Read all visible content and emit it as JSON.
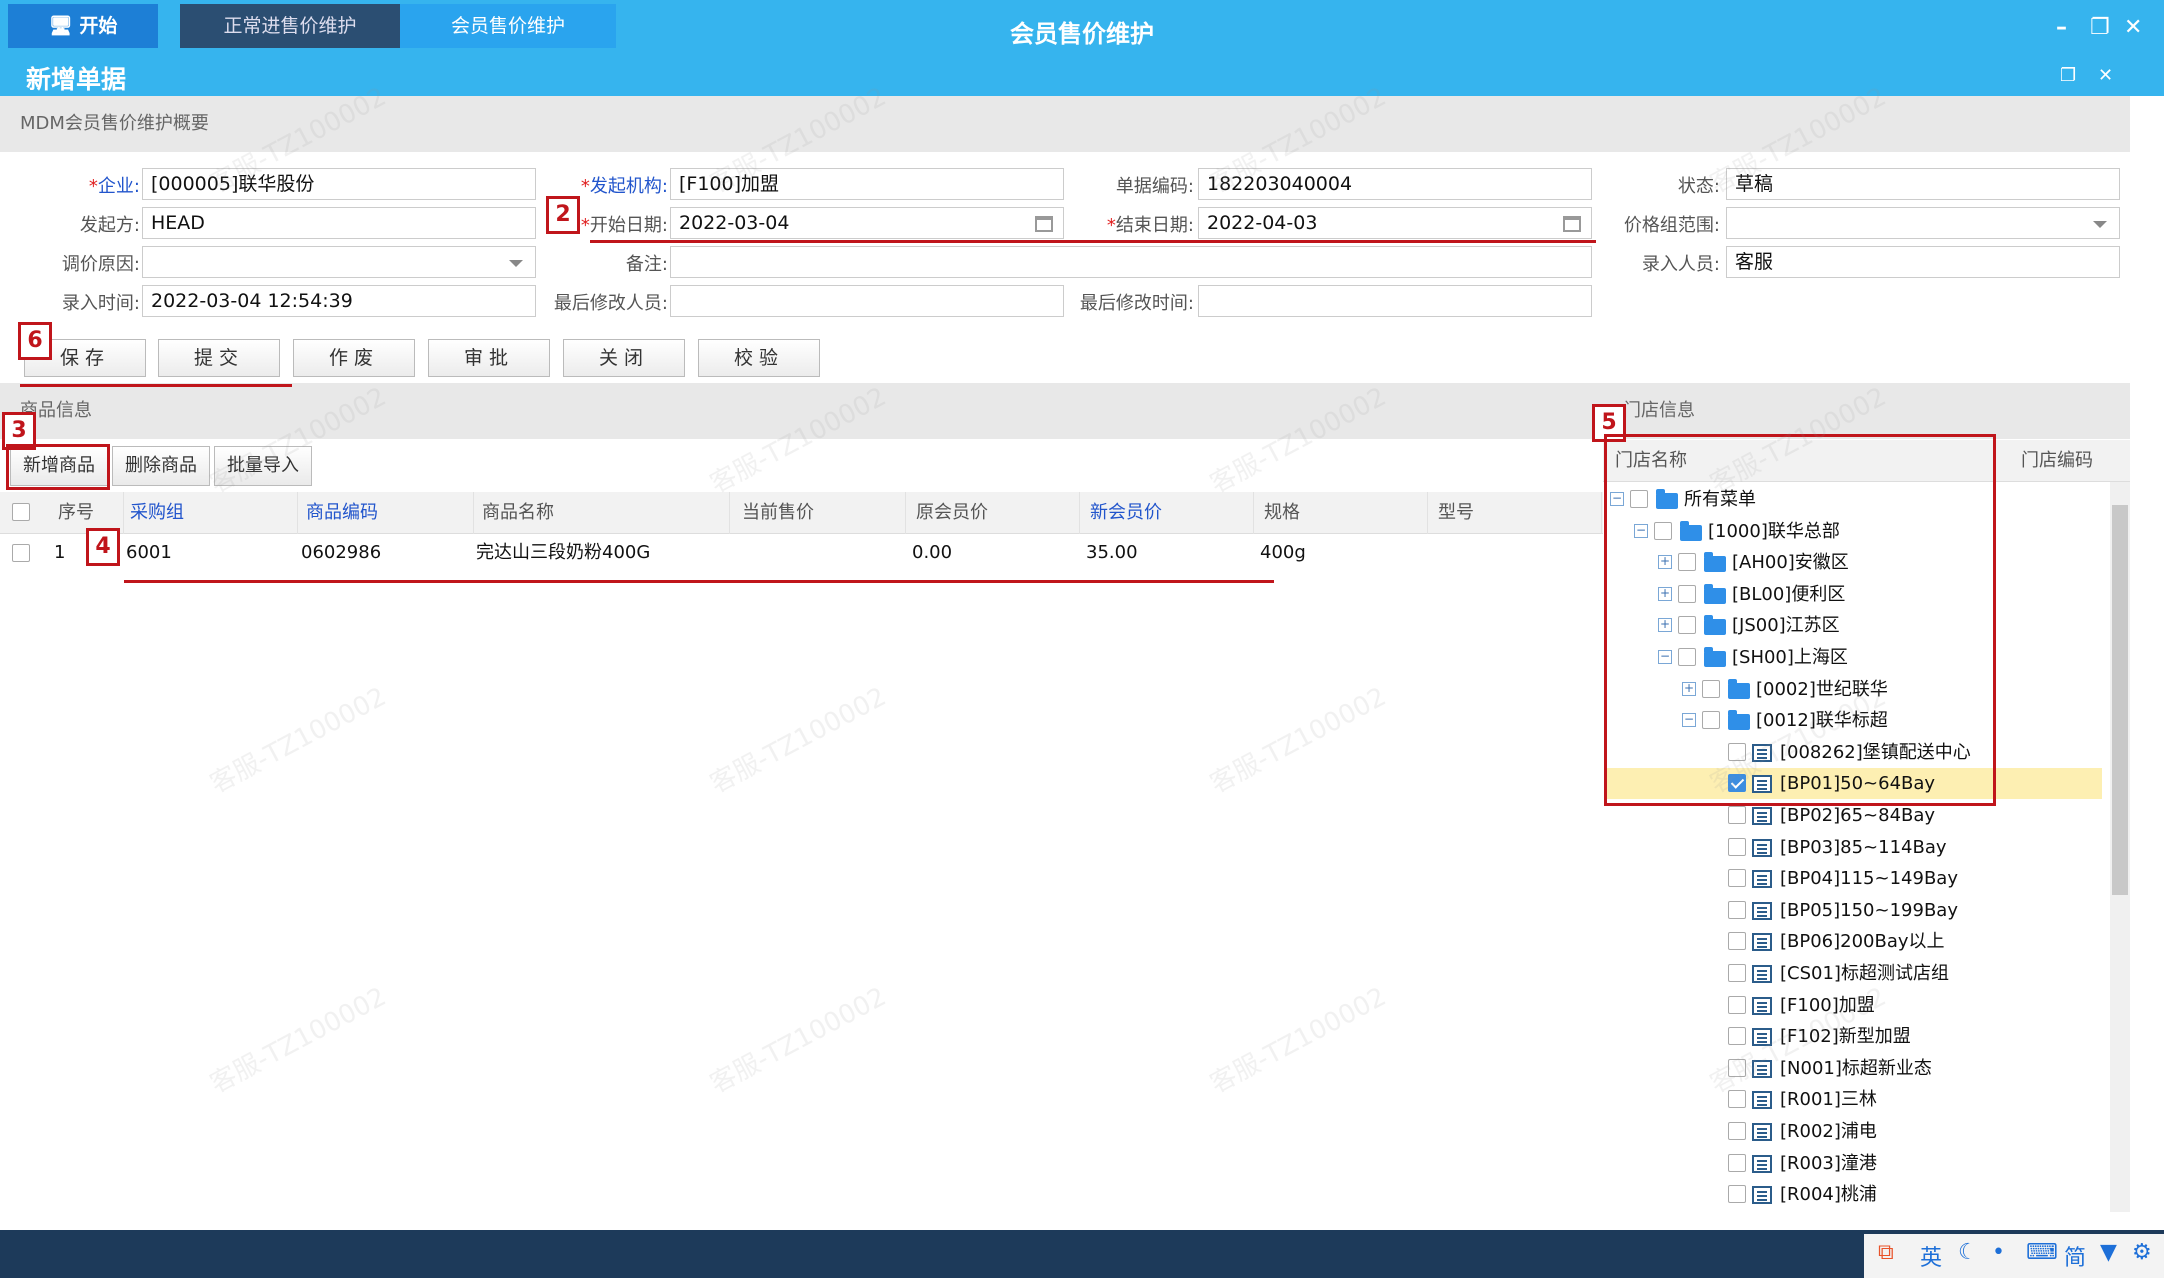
{
  "window": {
    "title": "会员售价维护",
    "subtitle": "新增单据"
  },
  "summary_title": "MDM会员售价维护概要",
  "form": {
    "company_label": "企业:",
    "company_value": "[000005]联华股份",
    "org_label": "发起机构:",
    "org_value": "[F100]加盟",
    "docno_label": "单据编码:",
    "docno_value": "182203040004",
    "status_label": "状态:",
    "status_value": "草稿",
    "initiator_label": "发起方:",
    "initiator_value": "HEAD",
    "start_label": "开始日期:",
    "start_value": "2022-03-04",
    "end_label": "结束日期:",
    "end_value": "2022-04-03",
    "pricegroup_label": "价格组范围:",
    "pricegroup_value": "",
    "reason_label": "调价原因:",
    "reason_value": "",
    "remark_label": "备注:",
    "remark_value": "",
    "entrant_label": "录入人员:",
    "entrant_value": "客服",
    "entrytime_label": "录入时间:",
    "entrytime_value": "2022-03-04 12:54:39",
    "modifier_label": "最后修改人员:",
    "modifier_value": "",
    "modtime_label": "最后修改时间:",
    "modtime_value": ""
  },
  "actions": {
    "save": "保存",
    "submit": "提交",
    "void": "作废",
    "approve": "审批",
    "close": "关闭",
    "verify": "校验"
  },
  "goods": {
    "section_title": "商品信息",
    "toolbar": {
      "add": "新增商品",
      "delete": "删除商品",
      "import": "批量导入"
    },
    "columns": [
      "序号",
      "采购组",
      "商品编码",
      "商品名称",
      "当前售价",
      "原会员价",
      "新会员价",
      "规格",
      "型号"
    ],
    "rows": [
      {
        "seq": "1",
        "group": "6001",
        "code": "0602986",
        "name": "完达山三段奶粉400G",
        "current": "",
        "orig": "0.00",
        "new": "35.00",
        "spec": "400g",
        "model": ""
      }
    ]
  },
  "stores": {
    "section_title": "门店信息",
    "col_name": "门店名称",
    "col_code": "门店编码",
    "tree": [
      {
        "label": "所有菜单",
        "level": 0,
        "type": "folder-open",
        "exp": "minus",
        "checked": false
      },
      {
        "label": "[1000]联华总部",
        "level": 1,
        "type": "folder-open",
        "exp": "minus",
        "checked": false
      },
      {
        "label": "[AH00]安徽区",
        "level": 2,
        "type": "folder",
        "exp": "plus",
        "checked": false
      },
      {
        "label": "[BL00]便利区",
        "level": 2,
        "type": "folder",
        "exp": "plus",
        "checked": false
      },
      {
        "label": "[JS00]江苏区",
        "level": 2,
        "type": "folder",
        "exp": "plus",
        "checked": false
      },
      {
        "label": "[SH00]上海区",
        "level": 2,
        "type": "folder-open",
        "exp": "minus",
        "checked": false
      },
      {
        "label": "[0002]世纪联华",
        "level": 3,
        "type": "folder",
        "exp": "plus",
        "checked": false
      },
      {
        "label": "[0012]联华标超",
        "level": 3,
        "type": "folder-open",
        "exp": "minus",
        "checked": false
      },
      {
        "label": "[008262]堡镇配送中心",
        "level": 4,
        "type": "leaf",
        "exp": "",
        "checked": false
      },
      {
        "label": "[BP01]50~64Bay",
        "level": 4,
        "type": "leaf",
        "exp": "",
        "checked": true
      },
      {
        "label": "[BP02]65~84Bay",
        "level": 4,
        "type": "leaf",
        "exp": "",
        "checked": false
      },
      {
        "label": "[BP03]85~114Bay",
        "level": 4,
        "type": "leaf",
        "exp": "",
        "checked": false
      },
      {
        "label": "[BP04]115~149Bay",
        "level": 4,
        "type": "leaf",
        "exp": "",
        "checked": false
      },
      {
        "label": "[BP05]150~199Bay",
        "level": 4,
        "type": "leaf",
        "exp": "",
        "checked": false
      },
      {
        "label": "[BP06]200Bay以上",
        "level": 4,
        "type": "leaf",
        "exp": "",
        "checked": false
      },
      {
        "label": "[CS01]标超测试店组",
        "level": 4,
        "type": "leaf",
        "exp": "",
        "checked": false
      },
      {
        "label": "[F100]加盟",
        "level": 4,
        "type": "leaf",
        "exp": "",
        "checked": false
      },
      {
        "label": "[F102]新型加盟",
        "level": 4,
        "type": "leaf",
        "exp": "",
        "checked": false
      },
      {
        "label": "[N001]标超新业态",
        "level": 4,
        "type": "leaf",
        "exp": "",
        "checked": false
      },
      {
        "label": "[R001]三林",
        "level": 4,
        "type": "leaf",
        "exp": "",
        "checked": false
      },
      {
        "label": "[R002]浦电",
        "level": 4,
        "type": "leaf",
        "exp": "",
        "checked": false
      },
      {
        "label": "[R003]潼港",
        "level": 4,
        "type": "leaf",
        "exp": "",
        "checked": false
      },
      {
        "label": "[R004]桃浦",
        "level": 4,
        "type": "leaf",
        "exp": "",
        "checked": false
      }
    ]
  },
  "annotations": [
    "2",
    "3",
    "4",
    "5",
    "6"
  ],
  "taskbar": {
    "start": "开始",
    "task1": "正常进售价维护",
    "task2": "会员售价维护",
    "tray_ime": "英",
    "tray_simp": "简"
  },
  "watermark": "客服-TZ100002",
  "colors": {
    "accent": "#36b4ee",
    "annotation": "#c0151b",
    "selected_row": "#fdefb2"
  }
}
